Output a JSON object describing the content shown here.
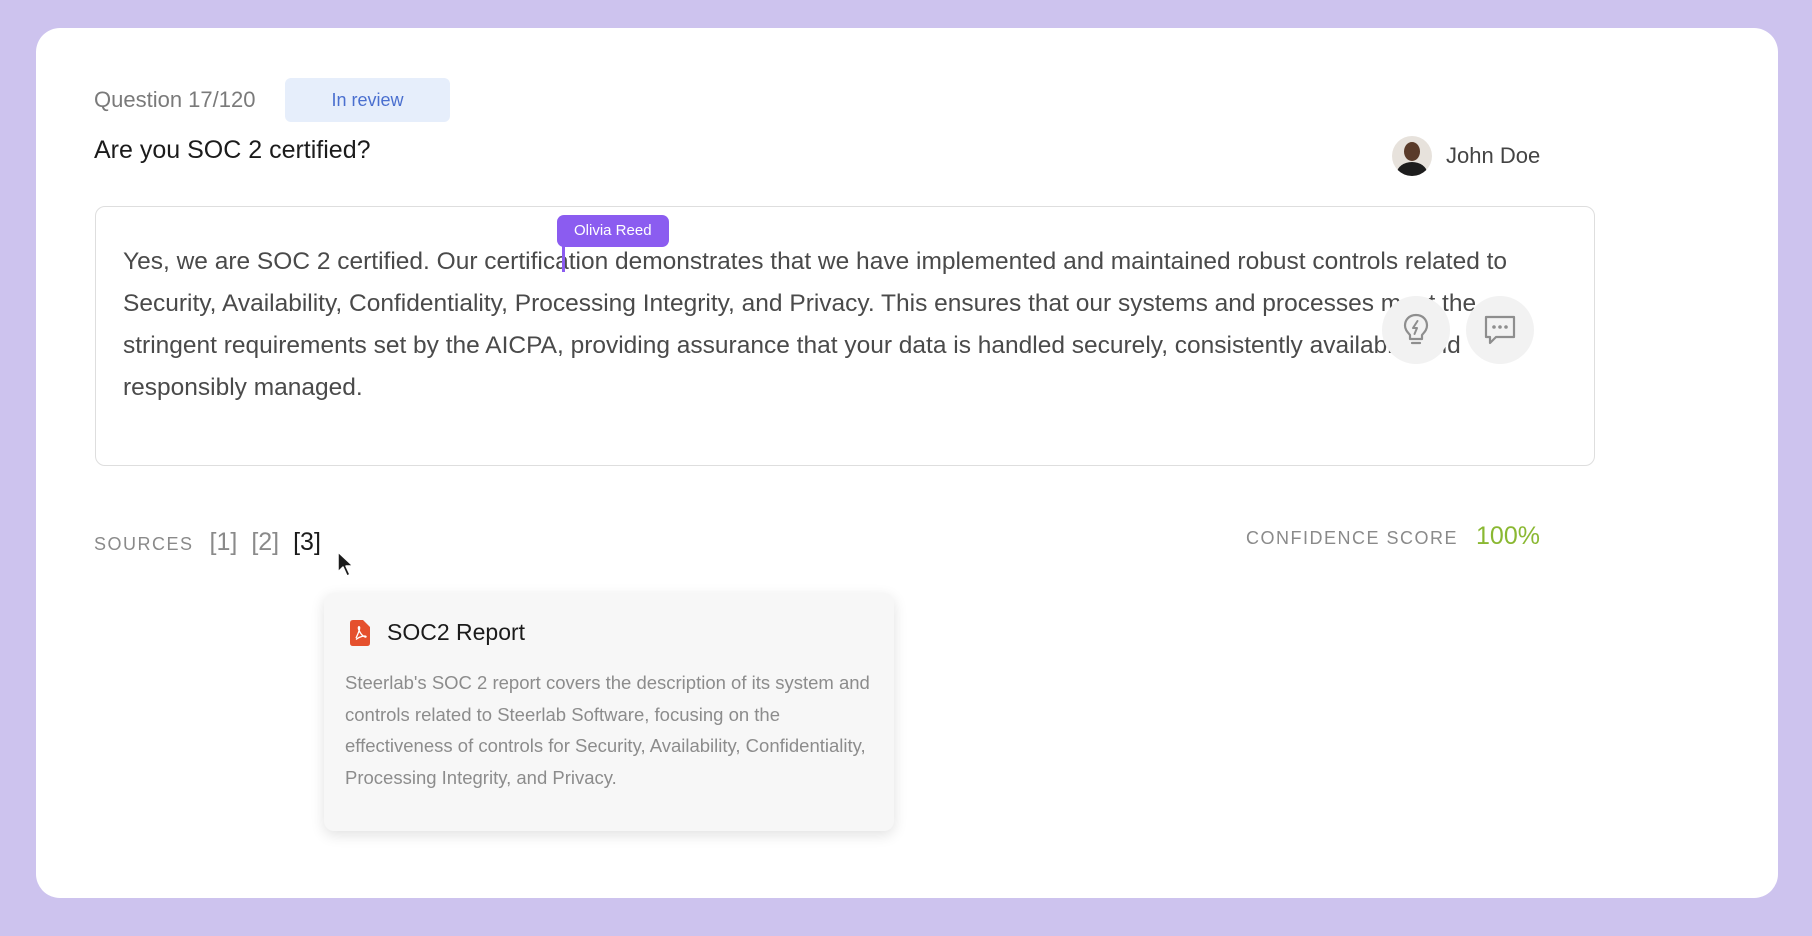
{
  "question": {
    "counter": "Question 17/120",
    "status": "In review",
    "text": "Are you SOC 2 certified?"
  },
  "assignee": {
    "name": "John Doe"
  },
  "answer": {
    "text": "Yes, we are SOC 2 certified. Our certification demonstrates that we have implemented and maintained robust controls related to Security, Availability, Confidentiality, Processing Integrity, and Privacy. This ensures that our systems and processes meet the stringent requirements set by the AICPA, providing assurance that your data is handled securely, consistently available, and responsibly managed.",
    "collaborator": "Olivia Reed"
  },
  "actions": {
    "suggest_icon": "lightbulb-icon",
    "comment_icon": "comment-icon"
  },
  "sources": {
    "label": "SOURCES",
    "items": [
      "[1]",
      "[2]",
      "[3]"
    ],
    "active_index": 2
  },
  "confidence": {
    "label": "CONFIDENCE SCORE",
    "value": "100%",
    "color": "#8ab832"
  },
  "source_preview": {
    "icon": "pdf-file-icon",
    "title": "SOC2 Report",
    "description": "Steerlab's SOC 2 report covers the description of its system and controls related to Steerlab Software, focusing on the effectiveness of controls for Security, Availability, Confidentiality, Processing Integrity, and Privacy."
  },
  "colors": {
    "background": "#cdc3ee",
    "accent": "#8b5cf0",
    "badge_bg": "#e6eefb",
    "badge_text": "#4a6fcf",
    "pdf_icon": "#e5502d"
  }
}
